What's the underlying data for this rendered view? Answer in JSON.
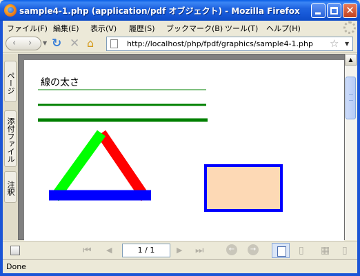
{
  "window": {
    "title": "sample4-1.php (application/pdf オブジェクト) - Mozilla Firefox",
    "minimize_icon": "minimize-icon",
    "maximize_icon": "maximize-icon",
    "close_glyph": "✕"
  },
  "menu": {
    "items": [
      "ファイル(F)",
      "編集(E)",
      "表示(V)",
      "履歴(S)",
      "ブックマーク(B)",
      "ツール(T)",
      "ヘルプ(H)"
    ]
  },
  "nav": {
    "back_glyph": "‹",
    "forward_glyph": "›",
    "reload_glyph": "↻",
    "stop_glyph": "✕",
    "home_glyph": "⌂",
    "url": "http://localhost/php/fpdf/graphics/sample4-1.php",
    "star_glyph": "☆"
  },
  "sidebar": {
    "tabs": [
      "ページ",
      "添付ファイル",
      "注釈"
    ]
  },
  "document": {
    "heading": "線の太さ",
    "colors": {
      "line_green": "#008000",
      "tri_green": "#00ff00",
      "tri_red": "#ff0000",
      "tri_blue": "#0000ff",
      "rect_fill": "#fdd9b5",
      "rect_border": "#0000ff"
    }
  },
  "pdf_toolbar": {
    "first_glyph": "⏮",
    "prev_glyph": "◀",
    "page_indicator": "1 / 1",
    "next_glyph": "▶",
    "last_glyph": "⏭",
    "back_glyph": "←",
    "forward_glyph": "→"
  },
  "status": {
    "text": "Done"
  }
}
